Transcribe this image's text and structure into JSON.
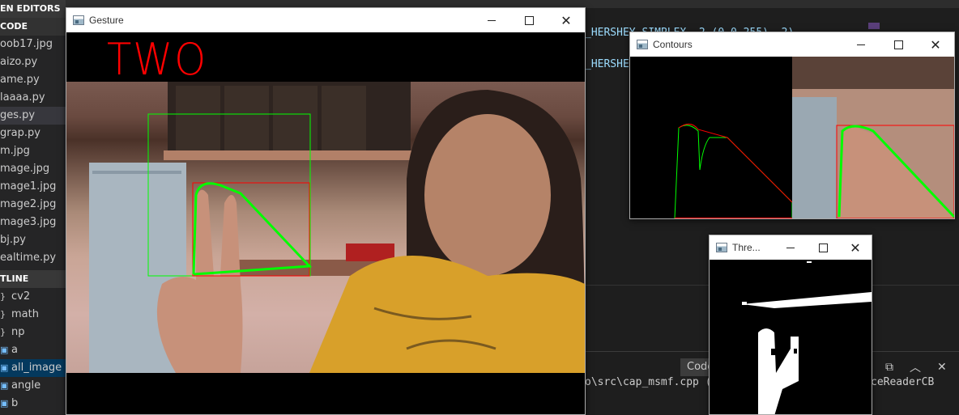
{
  "sidebar": {
    "open_editors_header": "EN EDITORS",
    "code_header": "CODE",
    "files": [
      {
        "label": "oob17.jpg"
      },
      {
        "label": "aizo.py"
      },
      {
        "label": "ame.py"
      },
      {
        "label": "laaaa.py"
      },
      {
        "label": "ges.py"
      },
      {
        "label": "grap.py"
      },
      {
        "label": "m.jpg"
      },
      {
        "label": "mage.jpg"
      },
      {
        "label": "mage1.jpg"
      },
      {
        "label": "mage2.jpg"
      },
      {
        "label": "mage3.jpg"
      },
      {
        "label": "bj.py"
      },
      {
        "label": "ealtime.py"
      }
    ],
    "outline_header": "TLINE",
    "outline": [
      {
        "icon": "}",
        "label": "cv2"
      },
      {
        "icon": "}",
        "label": "math"
      },
      {
        "icon": "}",
        "label": "np"
      },
      {
        "icon": "▣",
        "label": "a"
      },
      {
        "icon": "▣",
        "label": "all_image"
      },
      {
        "icon": "▣",
        "label": "angle"
      },
      {
        "icon": "▣",
        "label": "b"
      }
    ]
  },
  "editor": {
    "line1": "_HERSHEY_SIMPLEX, 2,(0,0,255), 2)",
    "line2": "_HERSHEY",
    "terminal_left": "o\\src\\cap_msmf.cpp (",
    "terminal_right": "ceReaderCB",
    "panel_tab": "Code"
  },
  "windows": {
    "gesture": {
      "title": "Gesture",
      "label": "TWO"
    },
    "contours": {
      "title": "Contours"
    },
    "threshold": {
      "title": "Thre..."
    }
  },
  "colors": {
    "label_red": "#ff0000",
    "contour_green": "#00ff00",
    "bbox_red": "#ff0000"
  }
}
